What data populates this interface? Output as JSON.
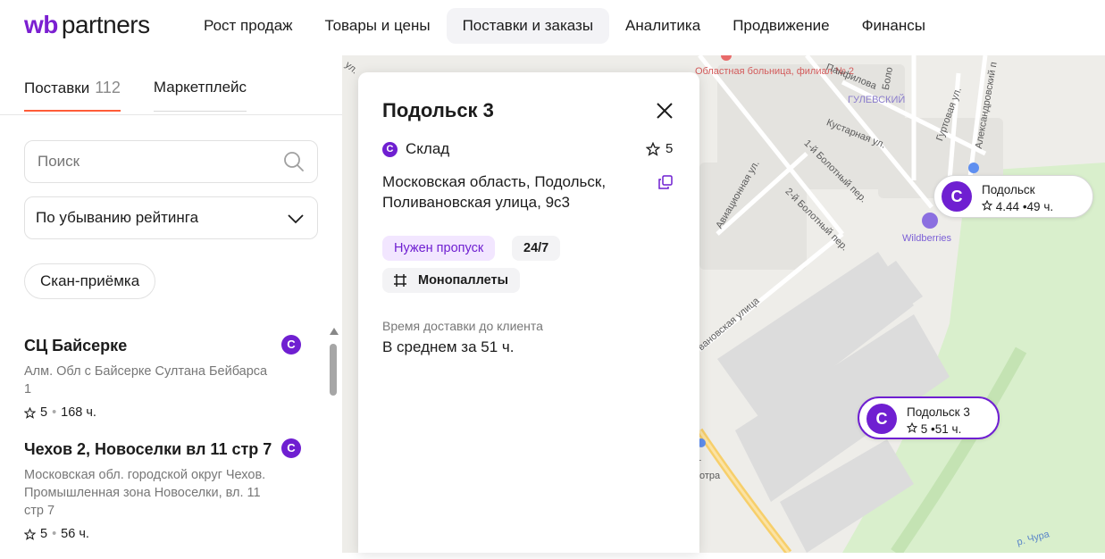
{
  "header": {
    "logo_prefix": "wb",
    "logo_text": "partners",
    "nav": [
      {
        "label": "Рост продаж"
      },
      {
        "label": "Товары и цены"
      },
      {
        "label": "Поставки и заказы"
      },
      {
        "label": "Аналитика"
      },
      {
        "label": "Продвижение"
      },
      {
        "label": "Финансы"
      }
    ]
  },
  "sidebar": {
    "tabs": [
      {
        "label": "Поставки",
        "count": "112"
      },
      {
        "label": "Маркетплейс"
      }
    ],
    "search_placeholder": "Поиск",
    "sort_label": "По убыванию рейтинга",
    "chip_label": "Скан-приёмка",
    "items": [
      {
        "title": "СЦ Байсерке",
        "badge": "С",
        "address": "Алм. Обл с Байсерке Султана Бейбарса 1",
        "rating": "5",
        "time": "168 ч."
      },
      {
        "title": "Чехов 2, Новоселки вл 11 стр 7",
        "badge": "С",
        "address": "Московская обл. городской округ Чехов. Промышленная зона Новоселки, вл. 11 стр 7",
        "rating": "5",
        "time": "56 ч."
      }
    ]
  },
  "card": {
    "title": "Подольск 3",
    "type_badge": "С",
    "type": "Склад",
    "rating": "5",
    "address": "Московская область, Подольск, Поливановская улица, 9с3",
    "tags": {
      "pass": "Нужен пропуск",
      "hours": "24/7",
      "pallets": "Монопаллеты"
    },
    "delivery_label": "Время доставки до клиента",
    "delivery_value": "В среднем за 51 ч."
  },
  "map": {
    "markers": [
      {
        "logo": "С",
        "name": "Подольск",
        "rating": "4.44",
        "time": "49 ч."
      },
      {
        "logo": "С",
        "name": "Подольск 3",
        "rating": "5",
        "time": "51 ч."
      }
    ],
    "labels": {
      "hospital": "Областная больница, филиал № 2",
      "district": "ГУЛЕВСКИЙ",
      "wildberries": "Wildberries",
      "street1": "Панфилова",
      "street2": "Кустарная ул.",
      "street3": "Гуртовая ул.",
      "street4": "Александровский п",
      "street5": "1-й Болотный пер.",
      "street6": "2-й Болотный пер.",
      "street7": "Авиационная ул.",
      "street8": "вановская улица",
      "street9": "р. Чура",
      "street10": "ул.",
      "street11": "кт",
      "street12": "отра",
      "street13": "Боло"
    },
    "colors": {
      "accent": "#6f1fd1",
      "forest": "#d7eec9",
      "road": "#f7cf6a"
    }
  }
}
